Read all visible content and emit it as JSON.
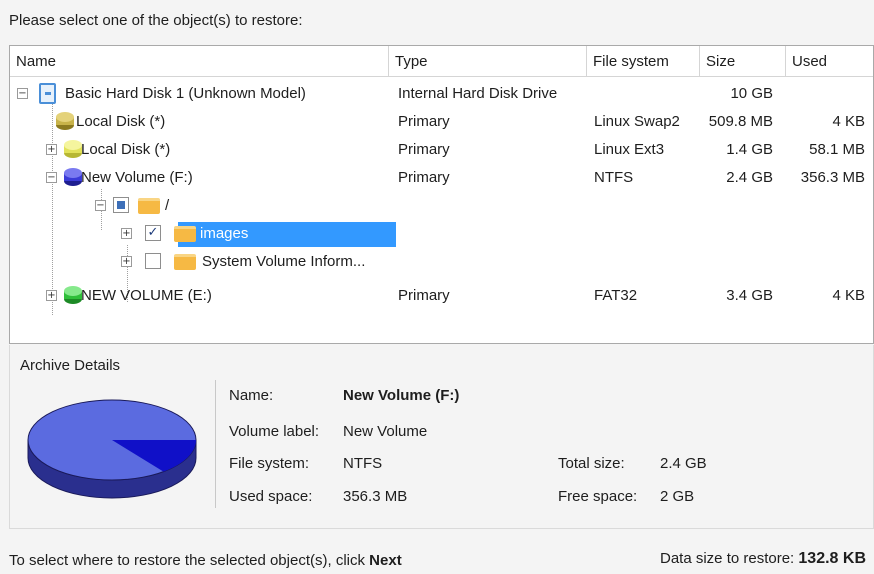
{
  "instruction": "Please select one of the object(s) to restore:",
  "columns": {
    "name": "Name",
    "type": "Type",
    "fs": "File system",
    "size": "Size",
    "used": "Used"
  },
  "rows": [
    {
      "name": "Basic Hard Disk 1 (Unknown Model)",
      "type": "Internal Hard Disk Drive",
      "fs": "",
      "size": "10 GB",
      "used": "",
      "icon": "hard-disk-icon"
    },
    {
      "name": "Local Disk (*)",
      "type": "Primary",
      "fs": "Linux Swap2",
      "size": "509.8 MB",
      "used": "4 KB",
      "icon": "swap-partition-icon",
      "color": "#c8b34a"
    },
    {
      "name": "Local Disk (*)",
      "type": "Primary",
      "fs": "Linux Ext3",
      "size": "1.4 GB",
      "used": "58.1 MB",
      "icon": "ext3-partition-icon",
      "color": "#e2e25a"
    },
    {
      "name": "New Volume (F:)",
      "type": "Primary",
      "fs": "NTFS",
      "size": "2.4 GB",
      "used": "356.3 MB",
      "icon": "ntfs-partition-icon",
      "color": "#3b3bd8"
    },
    {
      "name": "/",
      "icon": "folder-icon"
    },
    {
      "name": "images",
      "checked": true,
      "selected": true,
      "icon": "folder-icon"
    },
    {
      "name": "System Volume Inform...",
      "checked": false,
      "icon": "folder-icon"
    },
    {
      "name": "NEW VOLUME (E:)",
      "type": "Primary",
      "fs": "FAT32",
      "size": "3.4 GB",
      "used": "4 KB",
      "icon": "fat32-partition-icon",
      "color": "#2fbf3a"
    }
  ],
  "archive_details": {
    "title": "Archive Details",
    "name_label": "Name:",
    "name_value": "New Volume (F:)",
    "volume_label_label": "Volume label:",
    "volume_label_value": "New Volume",
    "file_system_label": "File system:",
    "file_system_value": "NTFS",
    "used_space_label": "Used space:",
    "used_space_value": "356.3 MB",
    "total_size_label": "Total size:",
    "total_size_value": "2.4 GB",
    "free_space_label": "Free space:",
    "free_space_value": "2 GB",
    "pie_used_fraction": 0.145,
    "pie_colors": {
      "free": "#5b6be0",
      "used": "#1010c8"
    }
  },
  "footer": {
    "hint_prefix": "To select where to restore the selected object(s), click",
    "hint_bold": "Next",
    "data_size_label": "Data size to restore:",
    "data_size_value": "132.8 KB"
  },
  "chevrons": {
    "plus": "+",
    "minus": "−",
    "check": "✓"
  }
}
